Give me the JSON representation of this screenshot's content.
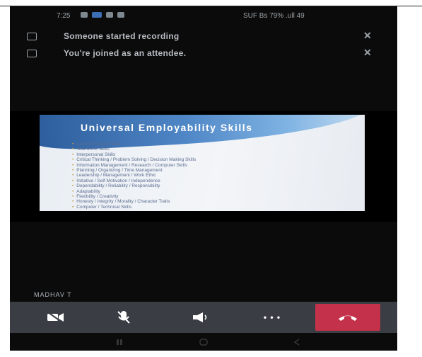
{
  "status_bar": {
    "time": "7:25",
    "right_text": "SUF Bs 79% .ull 49"
  },
  "notifications": [
    {
      "text": "Someone started recording",
      "close": "✕"
    },
    {
      "text": "You're joined as an attendee.",
      "close": "✕"
    }
  ],
  "slide": {
    "title": "Universal Employability Skills",
    "bullets": [
      "Communication Skills",
      "Teamwork Skills",
      "Interpersonal Skills",
      "Critical Thinking / Problem Solving / Decision Making Skills",
      "Information Management / Research / Computer Skills",
      "Planning / Organizing / Time Management",
      "Leadership / Management / Work Ethic",
      "Initiative / Self Motivation / Independence",
      "Dependability / Reliability / Responsibility",
      "Adaptability",
      "Flexibility / Creativity",
      "Honesty / Integrity / Morality / Character Traits",
      "Computer / Technical Skills"
    ]
  },
  "participant_name": "MADHAV T",
  "controls": {
    "camera_icon": "video-off-icon",
    "mic_icon": "mic-off-icon",
    "speaker_icon": "speaker-icon",
    "more_label": "• • •",
    "hangup_icon": "hang-up-icon",
    "hangup_color": "#c4314b"
  }
}
